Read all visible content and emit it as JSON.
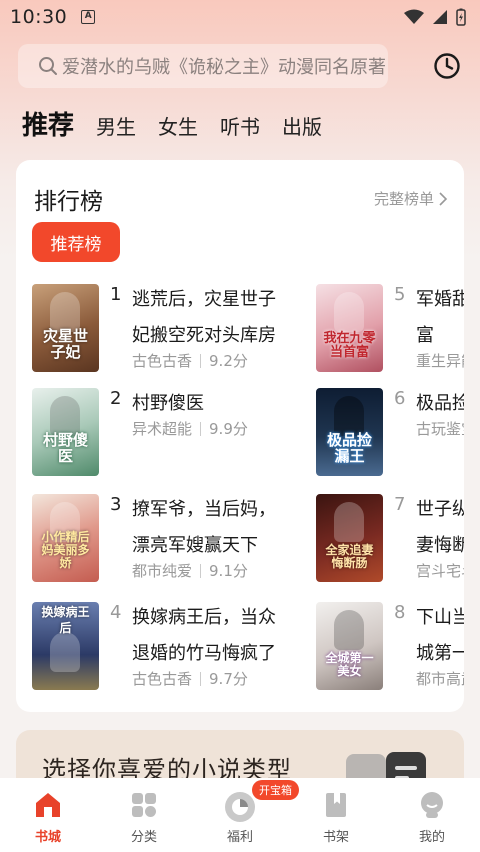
{
  "status": {
    "time": "10:30",
    "notif": "A"
  },
  "search": {
    "placeholder": "爱潜水的乌贼《诡秘之主》动漫同名原著"
  },
  "tabs": [
    "推荐",
    "男生",
    "女生",
    "听书",
    "出版"
  ],
  "ranking": {
    "title": "排行榜",
    "more": "完整榜单",
    "pill": "推荐榜",
    "books": [
      {
        "rank": "1",
        "title": "逃荒后，灾星世子妃搬空死对头库房",
        "genre": "古色古香",
        "score": "9.2分",
        "cover_text": "灾星世子妃",
        "cover_color": "#8a5a3a"
      },
      {
        "rank": "2",
        "title": "村野傻医",
        "genre": "异术超能",
        "score": "9.9分",
        "cover_text": "村野傻医",
        "cover_color": "#6f9e88"
      },
      {
        "rank": "3",
        "title": "撩军爷，当后妈，漂亮军嫂赢天下",
        "genre": "都市纯爱",
        "score": "9.1分",
        "cover_text": "小作精后妈美丽多娇",
        "cover_color": "#d36a5e"
      },
      {
        "rank": "4",
        "title": "换嫁病王后，当众退婚的竹马悔疯了",
        "genre": "古色古香",
        "score": "9.7分",
        "cover_text": "换嫁病王后",
        "cover_color": "#3b4a78"
      },
      {
        "rank": "5",
        "title": "军婚甜宠九零当首富",
        "genre": "重生异能",
        "score": "",
        "cover_text": "我在九零当首富",
        "cover_color": "#c66a72"
      },
      {
        "rank": "6",
        "title": "极品捡漏王",
        "genre": "古玩鉴宝",
        "score": "",
        "cover_text": "极品捡漏王",
        "cover_color": "#1f3550"
      },
      {
        "rank": "7",
        "title": "世子纵宠，全家追妻悔断肠",
        "genre": "宫斗宅斗",
        "score": "",
        "cover_text": "全家追妻悔断肠",
        "cover_color": "#7a2a22"
      },
      {
        "rank": "8",
        "title": "下山当日，娶了全城第一美女",
        "genre": "都市高武",
        "score": "",
        "cover_text": "全城第一美女",
        "cover_color": "#b7a9a4"
      }
    ]
  },
  "genre_banner": {
    "text": "选择你喜爱的小说类型"
  },
  "bottom_nav": [
    {
      "label": "书城",
      "icon": "home-icon",
      "active": true
    },
    {
      "label": "分类",
      "icon": "category-grid-icon",
      "active": false
    },
    {
      "label": "福利",
      "icon": "welfare-icon",
      "active": false,
      "badge": "开宝箱"
    },
    {
      "label": "书架",
      "icon": "bookshelf-icon",
      "active": false
    },
    {
      "label": "我的",
      "icon": "profile-icon",
      "active": false
    }
  ],
  "colors": {
    "accent": "#f2482b",
    "muted": "#999999"
  }
}
